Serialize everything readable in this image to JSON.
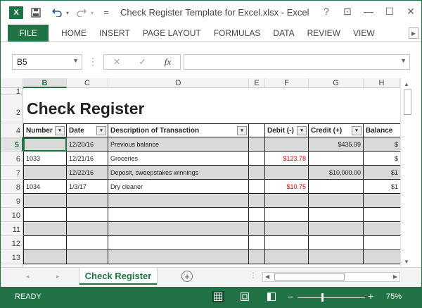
{
  "window": {
    "title": "Check Register Template for Excel.xlsx - Excel",
    "app_logo": "X",
    "help": "?",
    "restore_ribbon": "⊡",
    "minimize": "—",
    "maximize": "☐",
    "close": "✕"
  },
  "qat": {
    "save_icon": "disk-icon",
    "undo_icon": "undo-icon",
    "redo_icon": "redo-icon",
    "customize": "="
  },
  "ribbon": {
    "file": "FILE",
    "tabs": [
      "HOME",
      "INSERT",
      "PAGE LAYOUT",
      "FORMULAS",
      "DATA",
      "REVIEW",
      "VIEW"
    ]
  },
  "formula_bar": {
    "name_box": "B5",
    "separator": "⋮",
    "cancel": "✕",
    "enter": "✓",
    "fx": "fx",
    "value": ""
  },
  "columns": [
    "B",
    "C",
    "D",
    "E",
    "F",
    "G",
    "H"
  ],
  "selected_column": "B",
  "rows": [
    "1",
    "2",
    "4",
    "5",
    "6",
    "7",
    "8",
    "9",
    "10",
    "11",
    "12",
    "13"
  ],
  "selected_row": "5",
  "sheet": {
    "title": "Check Register",
    "headers": {
      "number": "Number",
      "date": "Date",
      "description": "Description of Transaction",
      "e": "",
      "debit": "Debit  (-)",
      "credit": "Credit (+)",
      "balance": "Balance"
    },
    "entries": [
      {
        "number": "",
        "date": "12/20/16",
        "description": "Previous balance",
        "debit": "",
        "credit": "$435.99",
        "balance": "$"
      },
      {
        "number": "1033",
        "date": "12/21/16",
        "description": "Groceries",
        "debit": "$123.78",
        "credit": "",
        "balance": "$"
      },
      {
        "number": "",
        "date": "12/22/16",
        "description": "Deposit, sweepstakes winnings",
        "debit": "",
        "credit": "$10,000.00",
        "balance": "$1"
      },
      {
        "number": "1034",
        "date": "1/3/17",
        "description": "Dry cleaner",
        "debit": "$10.75",
        "credit": "",
        "balance": "$1"
      }
    ],
    "filter_icon": "▾"
  },
  "sheet_tabs": {
    "active": "Check Register",
    "add": "+",
    "nav": "◂ ▸",
    "dots": "⋮"
  },
  "status": {
    "ready": "READY",
    "zoom_minus": "−",
    "zoom_plus": "+",
    "zoom": "75%",
    "zoom_level": 0.5
  },
  "colors": {
    "accent": "#217346",
    "negative": "#e00000",
    "row_shade": "#d9d9d9"
  }
}
